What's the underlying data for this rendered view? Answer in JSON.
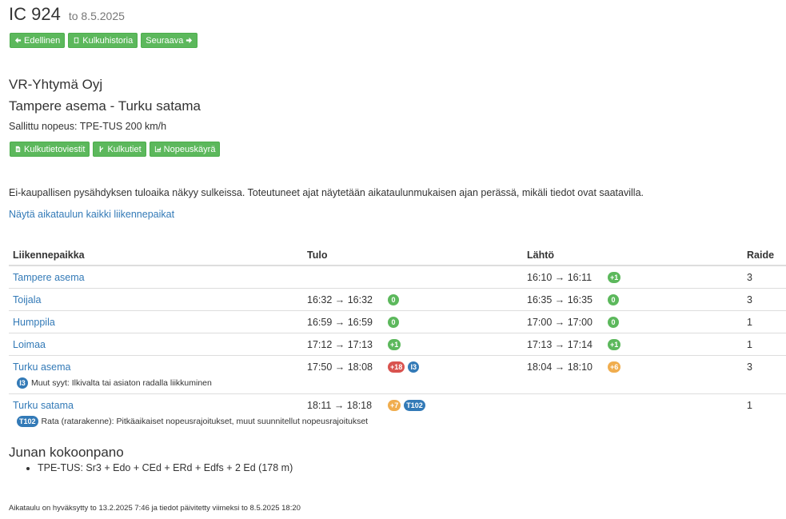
{
  "header": {
    "title": "IC 924",
    "date": "to 8.5.2025"
  },
  "nav_buttons": {
    "prev": "Edellinen",
    "history": "Kulkuhistoria",
    "next": "Seuraava"
  },
  "operator": "VR-Yhtymä Oyj",
  "route": "Tampere asema - Turku satama",
  "speed": "Sallittu nopeus: TPE-TUS 200 km/h",
  "info_buttons": {
    "notices": "Kulkutietoviestit",
    "routes": "Kulkutiet",
    "speed_chart": "Nopeuskäyrä"
  },
  "info_text": "Ei-kaupallisen pysähdyksen tuloaika näkyy sulkeissa. Toteutuneet ajat näytetään aikataulunmukaisen ajan perässä, mikäli tiedot ovat saatavilla.",
  "show_all_link": "Näytä aikataulun kaikki liikennepaikat",
  "table": {
    "headers": {
      "place": "Liikennepaikka",
      "arrival": "Tulo",
      "departure": "Lähtö",
      "track": "Raide"
    },
    "rows": [
      {
        "place": "Tampere asema",
        "arrival": "",
        "arr_badges": [],
        "departure": "16:10 → 16:11",
        "dep_badges": [
          {
            "text": "+1",
            "color": "#5cb85c"
          }
        ],
        "track": "3"
      },
      {
        "place": "Toijala",
        "arrival": "16:32 → 16:32",
        "arr_badges": [
          {
            "text": "0",
            "color": "#5cb85c"
          }
        ],
        "departure": "16:35 → 16:35",
        "dep_badges": [
          {
            "text": "0",
            "color": "#5cb85c"
          }
        ],
        "track": "3"
      },
      {
        "place": "Humppila",
        "arrival": "16:59 → 16:59",
        "arr_badges": [
          {
            "text": "0",
            "color": "#5cb85c"
          }
        ],
        "departure": "17:00 → 17:00",
        "dep_badges": [
          {
            "text": "0",
            "color": "#5cb85c"
          }
        ],
        "track": "1"
      },
      {
        "place": "Loimaa",
        "arrival": "17:12 → 17:13",
        "arr_badges": [
          {
            "text": "+1",
            "color": "#5cb85c"
          }
        ],
        "departure": "17:13 → 17:14",
        "dep_badges": [
          {
            "text": "+1",
            "color": "#5cb85c"
          }
        ],
        "track": "1"
      },
      {
        "place": "Turku asema",
        "arrival": "17:50 → 18:08",
        "arr_badges": [
          {
            "text": "+18",
            "color": "#d9534f"
          },
          {
            "text": "I3",
            "color": "#337ab7"
          }
        ],
        "departure": "18:04 → 18:10",
        "dep_badges": [
          {
            "text": "+6",
            "color": "#f0ad4e"
          }
        ],
        "track": "3",
        "note": {
          "code": "I3",
          "text": "Muut syyt: Ilkivalta tai asiaton radalla liikkuminen"
        }
      },
      {
        "place": "Turku satama",
        "arrival": "18:11 → 18:18",
        "arr_badges": [
          {
            "text": "+7",
            "color": "#f0ad4e"
          },
          {
            "text": "T102",
            "color": "#337ab7"
          }
        ],
        "departure": "",
        "dep_badges": [],
        "track": "1",
        "note": {
          "code": "T102",
          "text": "Rata (ratarakenne): Pitkäaikaiset nopeusrajoitukset, muut suunnitellut nopeusrajoitukset"
        }
      }
    ]
  },
  "composition": {
    "title": "Junan kokoonpano",
    "items": [
      "TPE-TUS: Sr3 + Edo + CEd + ERd + Edfs + 2 Ed (178 m)"
    ]
  },
  "footer": "Aikataulu on hyväksytty to 13.2.2025 7:46 ja tiedot päivitetty viimeksi to 8.5.2025 18:20"
}
